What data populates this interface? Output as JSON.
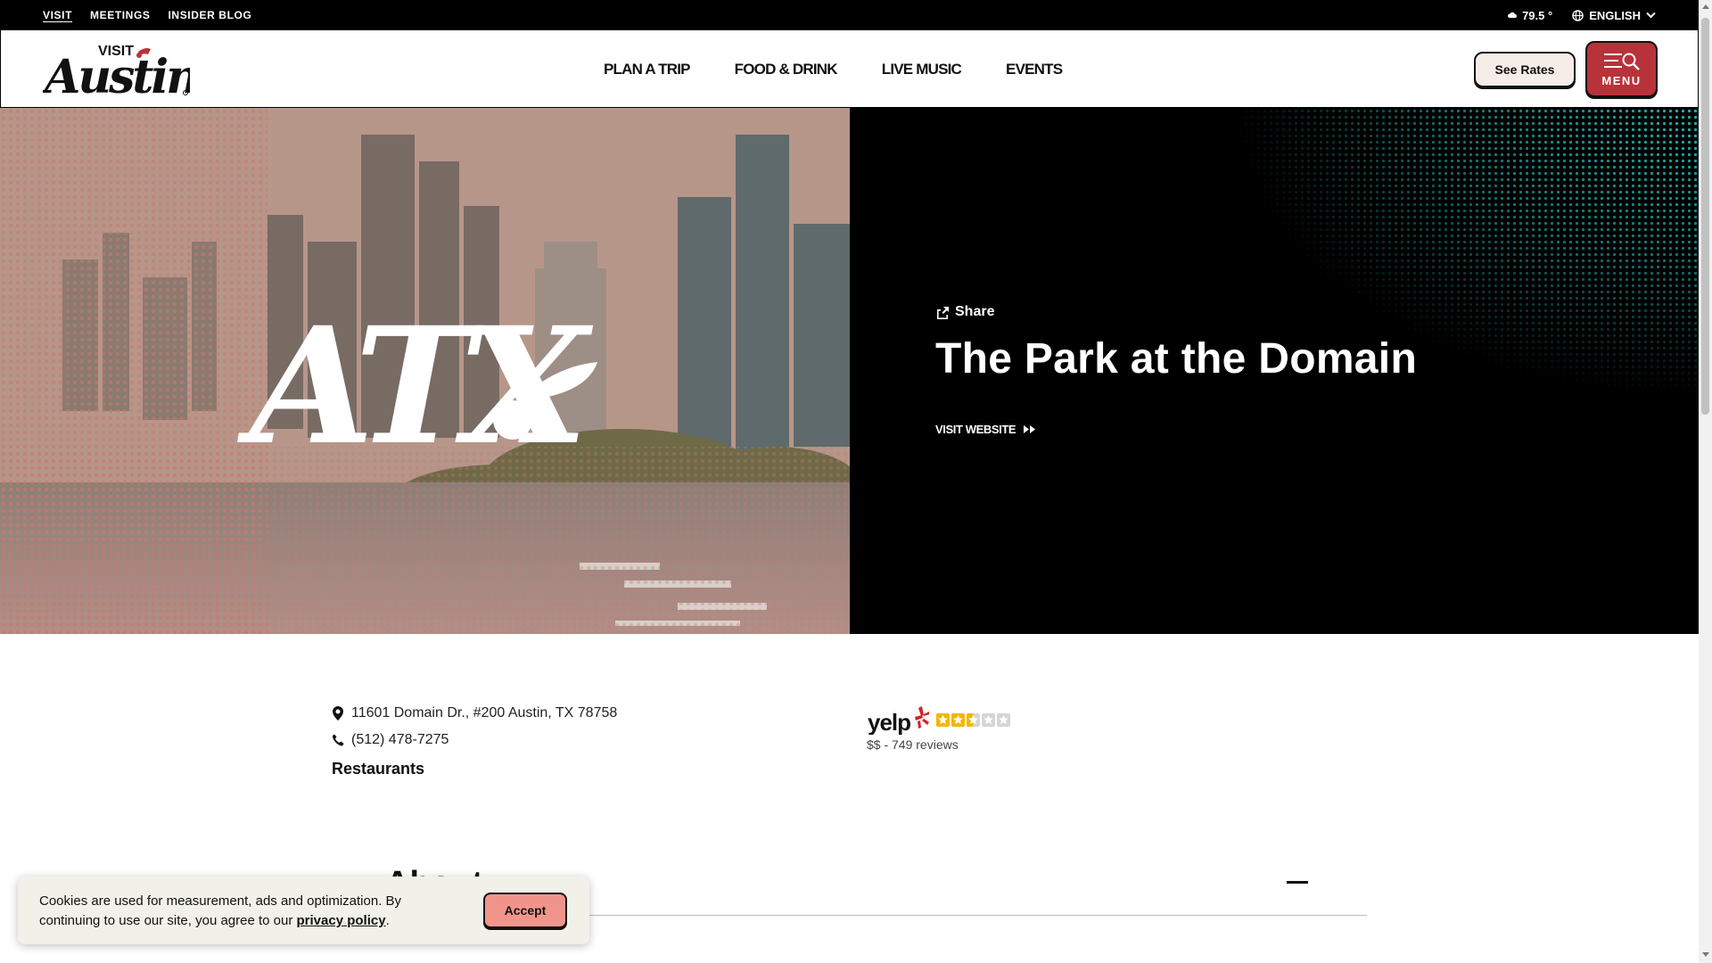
{
  "utility_bar": {
    "links": [
      "VISIT",
      "MEETINGS",
      "INSIDER BLOG"
    ],
    "weather": "79.5 °",
    "language": "ENGLISH"
  },
  "header": {
    "logo_top": "VISIT",
    "logo_word": "Austin",
    "nav": [
      "PLAN A TRIP",
      "FOOD & DRINK",
      "LIVE MUSIC",
      "EVENTS"
    ],
    "see_rates": "See Rates",
    "menu": "MENU"
  },
  "hero": {
    "share": "Share",
    "title": "The Park at the Domain",
    "visit_website": "VISIT WEBSITE",
    "image_logo_text": "ATX"
  },
  "details": {
    "address": "11601 Domain Dr., #200 Austin, TX 78758",
    "phone": "(512) 478-7275",
    "category": "Restaurants"
  },
  "yelp": {
    "brand": "yelp",
    "rating": 2.5,
    "rating_max": 5,
    "meta": "$$ - 749 reviews"
  },
  "about": {
    "heading": "About"
  },
  "cookie": {
    "text": "Cookies are used for measurement, ads and optimization. By continuing to use our site, you agree to our ",
    "link": "privacy policy",
    "period": ".",
    "accept": "Accept"
  },
  "colors": {
    "accent_red": "#b8323a",
    "accept_pink": "#f1958c",
    "rates_bg": "#f6ede9",
    "teal_dots": "#1fb5b0",
    "star": "#f2b705"
  },
  "icons": [
    "cloud-icon",
    "globe-icon",
    "chevron-down-icon",
    "menu-search-icon",
    "share-icon",
    "fast-forward-icon",
    "map-pin-icon",
    "phone-icon",
    "star-icon",
    "minus-icon"
  ]
}
